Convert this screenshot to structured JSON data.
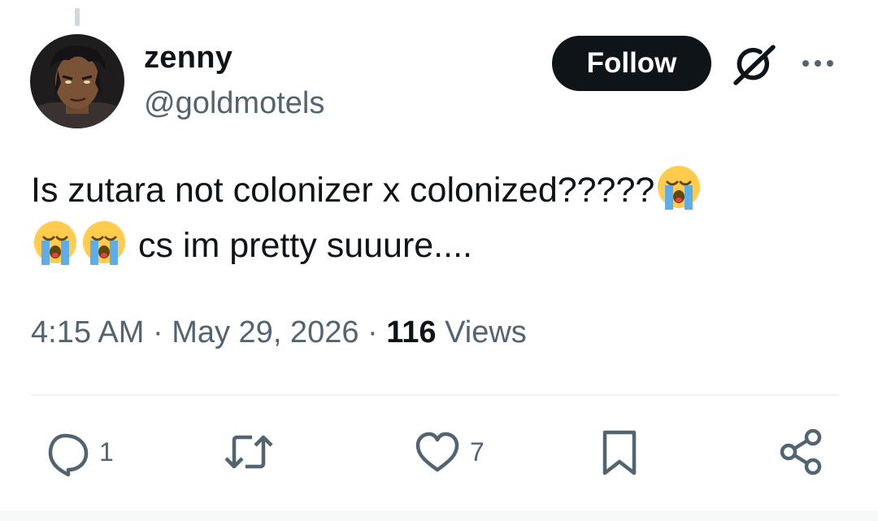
{
  "author": {
    "name": "zenny",
    "handle": "@goldmotels"
  },
  "follow_label": "Follow",
  "tweet": {
    "text_part1": "Is zutara not colonizer x colonized?????",
    "text_part2": " cs im pretty suuure....",
    "emoji": "loudly-crying-face"
  },
  "meta": {
    "time": "4:15 AM",
    "separator": " · ",
    "date": "May 29, 2026",
    "views_count": "116",
    "views_label": " Views"
  },
  "actions": {
    "reply_count": "1",
    "like_count": "7"
  },
  "colors": {
    "text": "#0f1419",
    "secondary": "#536471",
    "button_bg": "#0f1419",
    "divider": "#eff3f4"
  }
}
